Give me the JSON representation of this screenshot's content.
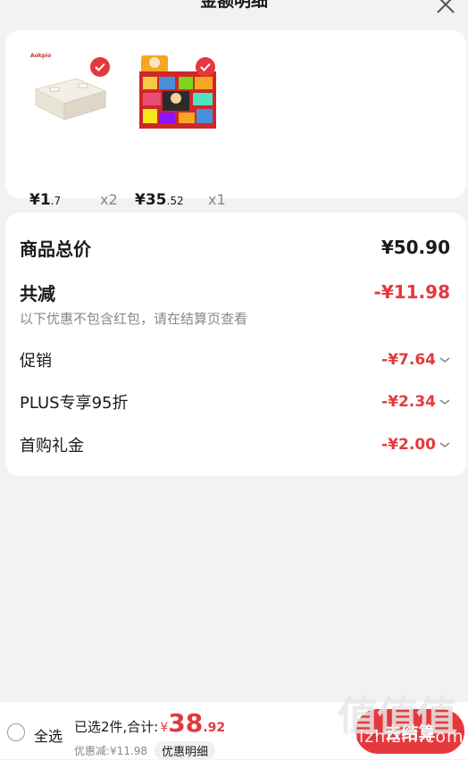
{
  "header": {
    "title": "金额明细"
  },
  "products": [
    {
      "brand": "Aokpio",
      "price_int": "¥1",
      "price_dec": ".7",
      "qty": "x2"
    },
    {
      "price_int": "¥35",
      "price_dec": ".52",
      "qty": "x1"
    }
  ],
  "summary": {
    "total_label": "商品总价",
    "total_value": "¥50.90",
    "reduce_label": "共减",
    "reduce_value": "-¥11.98",
    "note": "以下优惠不包含红包，请在结算页查看",
    "discounts": [
      {
        "label": "促销",
        "value": "-¥7.64"
      },
      {
        "label": "PLUS专享95折",
        "value": "-¥2.34"
      },
      {
        "label": "首购礼金",
        "value": "-¥2.00"
      }
    ]
  },
  "bottom": {
    "select_all": "全选",
    "selected_text": "已选2件,合计:",
    "currency": "¥",
    "total_int": "38",
    "total_dec": ".92",
    "discount_text": "优惠减:¥11.98",
    "detail_label": "优惠明细",
    "checkout_label": "去结算"
  },
  "watermark": {
    "big": "值值值",
    "small": "zhizhizhi.com"
  },
  "colors": {
    "accent": "#e4393c",
    "background": "#f2f2f2"
  }
}
